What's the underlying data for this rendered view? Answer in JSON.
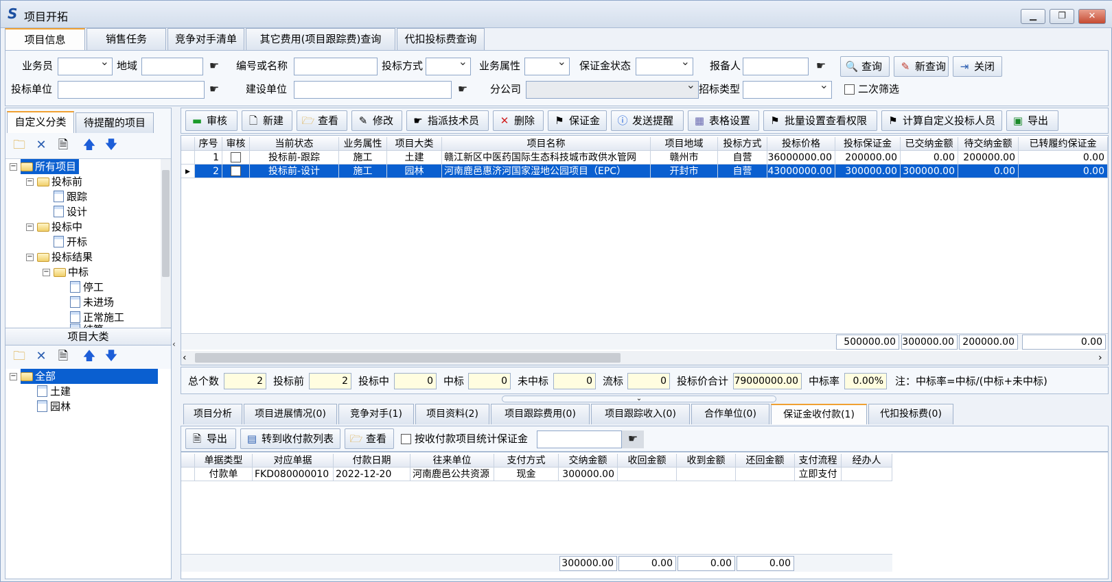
{
  "window": {
    "title": "项目开拓",
    "min": "▁",
    "max": "❐",
    "close": "✕",
    "colors": {
      "selection": "#0a5fd0",
      "tab_accent": "#f0a030"
    }
  },
  "tabs": [
    "项目信息",
    "销售任务",
    "竞争对手清单",
    "其它费用(项目跟踪费)查询",
    "代扣投标费查询"
  ],
  "filters": {
    "salesman": "业务员",
    "region": "地域",
    "code_or_name": "编号或名称",
    "bid_method": "投标方式",
    "biz_attr": "业务属性",
    "deposit_status": "保证金状态",
    "reporter": "报备人",
    "bid_unit": "投标单位",
    "build_unit": "建设单位",
    "branch": "分公司",
    "tender_type": "招标类型",
    "second_filter": "二次筛选"
  },
  "actions": {
    "query": "查询",
    "new_query": "新查询",
    "close": "关闭"
  },
  "left_tabs": [
    "自定义分类",
    "待提醒的项目"
  ],
  "tree": [
    {
      "label": "所有项目",
      "level": 0,
      "type": "folder"
    },
    {
      "label": "投标前",
      "level": 1,
      "type": "folder"
    },
    {
      "label": "跟踪",
      "level": 2,
      "type": "doc"
    },
    {
      "label": "设计",
      "level": 2,
      "type": "doc"
    },
    {
      "label": "投标中",
      "level": 1,
      "type": "folder"
    },
    {
      "label": "开标",
      "level": 2,
      "type": "doc"
    },
    {
      "label": "投标结果",
      "level": 1,
      "type": "folder"
    },
    {
      "label": "中标",
      "level": 2,
      "type": "folder"
    },
    {
      "label": "停工",
      "level": 3,
      "type": "doc"
    },
    {
      "label": "未进场",
      "level": 3,
      "type": "doc"
    },
    {
      "label": "正常施工",
      "level": 3,
      "type": "doc"
    },
    {
      "label": "结算",
      "level": 3,
      "type": "doc"
    }
  ],
  "category_title": "项目大类",
  "category_tree": [
    {
      "label": "全部",
      "level": 0,
      "type": "folder"
    },
    {
      "label": "土建",
      "level": 1,
      "type": "doc"
    },
    {
      "label": "园林",
      "level": 1,
      "type": "doc"
    }
  ],
  "toolbar": [
    "审核",
    "新建",
    "查看",
    "修改",
    "指派技术员",
    "删除",
    "保证金",
    "发送提醒",
    "表格设置",
    "批量设置查看权限",
    "计算自定义投标人员",
    "导出"
  ],
  "main_grid": {
    "columns": [
      "序号",
      "审核",
      "当前状态",
      "业务属性",
      "项目大类",
      "项目名称",
      "项目地域",
      "投标方式",
      "投标价格",
      "投标保证金",
      "已交纳金额",
      "待交纳金额",
      "已转履约保证金"
    ],
    "rows": [
      [
        "1",
        "",
        "投标前-跟踪",
        "施工",
        "土建",
        "赣江新区中医药国际生态科技城市政供水管网",
        "赣州市",
        "自营",
        "36000000.00",
        "200000.00",
        "0.00",
        "200000.00",
        "0.00"
      ],
      [
        "2",
        "",
        "投标前-设计",
        "施工",
        "园林",
        "河南鹿邑惠济河国家湿地公园项目（EPC）",
        "开封市",
        "自营",
        "43000000.00",
        "300000.00",
        "300000.00",
        "0.00",
        "0.00"
      ]
    ],
    "totals": [
      "500000.00",
      "300000.00",
      "200000.00",
      "0.00"
    ]
  },
  "stats": [
    {
      "label": "总个数",
      "value": "2"
    },
    {
      "label": "投标前",
      "value": "2"
    },
    {
      "label": "投标中",
      "value": "0"
    },
    {
      "label": "中标",
      "value": "0"
    },
    {
      "label": "未中标",
      "value": "0"
    },
    {
      "label": "流标",
      "value": "0"
    },
    {
      "label": "投标价合计",
      "value": "79000000.00"
    },
    {
      "label": "中标率",
      "value": "0.00%"
    }
  ],
  "stats_note": "注：中标率=中标/(中标+未中标)",
  "bottom_tabs": [
    "项目分析",
    "项目进展情况(0)",
    "竞争对手(1)",
    "项目资料(2)",
    "项目跟踪费用(0)",
    "项目跟踪收入(0)",
    "合作单位(0)",
    "保证金收付款(1)",
    "代扣投标费(0)"
  ],
  "bottom_toolbar": {
    "export": "导出",
    "to_list": "转到收付款列表",
    "view": "查看",
    "stat_check": "按收付款项目统计保证金"
  },
  "pay_grid": {
    "columns": [
      "单据类型",
      "对应单据",
      "付款日期",
      "往来单位",
      "支付方式",
      "交纳金额",
      "收回金额",
      "收到金额",
      "还回金额",
      "支付流程",
      "经办人"
    ],
    "rows": [
      [
        "付款单",
        "FKD080000010",
        "2022-12-20",
        "河南鹿邑公共资源",
        "现金",
        "300000.00",
        "",
        "",
        "",
        "立即支付",
        ""
      ]
    ],
    "totals": [
      "300000.00",
      "0.00",
      "0.00",
      "0.00"
    ]
  }
}
